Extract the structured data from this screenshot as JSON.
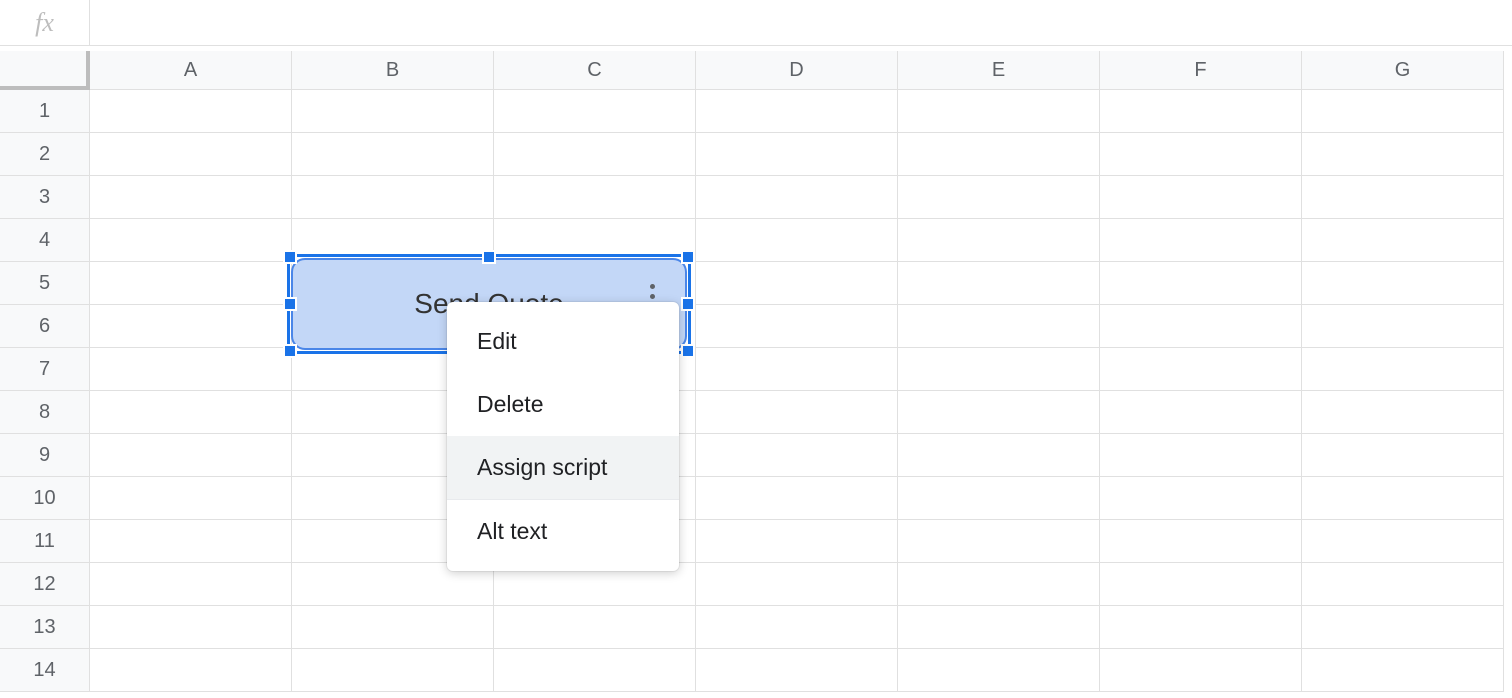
{
  "formula_bar": {
    "value": ""
  },
  "columns": [
    "A",
    "B",
    "C",
    "D",
    "E",
    "F",
    "G"
  ],
  "rows": [
    "1",
    "2",
    "3",
    "4",
    "5",
    "6",
    "7",
    "8",
    "9",
    "10",
    "11",
    "12",
    "13",
    "14"
  ],
  "drawing": {
    "label": "Send Quote"
  },
  "context_menu": {
    "items": [
      {
        "label": "Edit",
        "highlighted": false,
        "separator": false
      },
      {
        "label": "Delete",
        "highlighted": false,
        "separator": false
      },
      {
        "label": "Assign script",
        "highlighted": true,
        "separator": true
      },
      {
        "label": "Alt text",
        "highlighted": false,
        "separator": false
      }
    ]
  }
}
